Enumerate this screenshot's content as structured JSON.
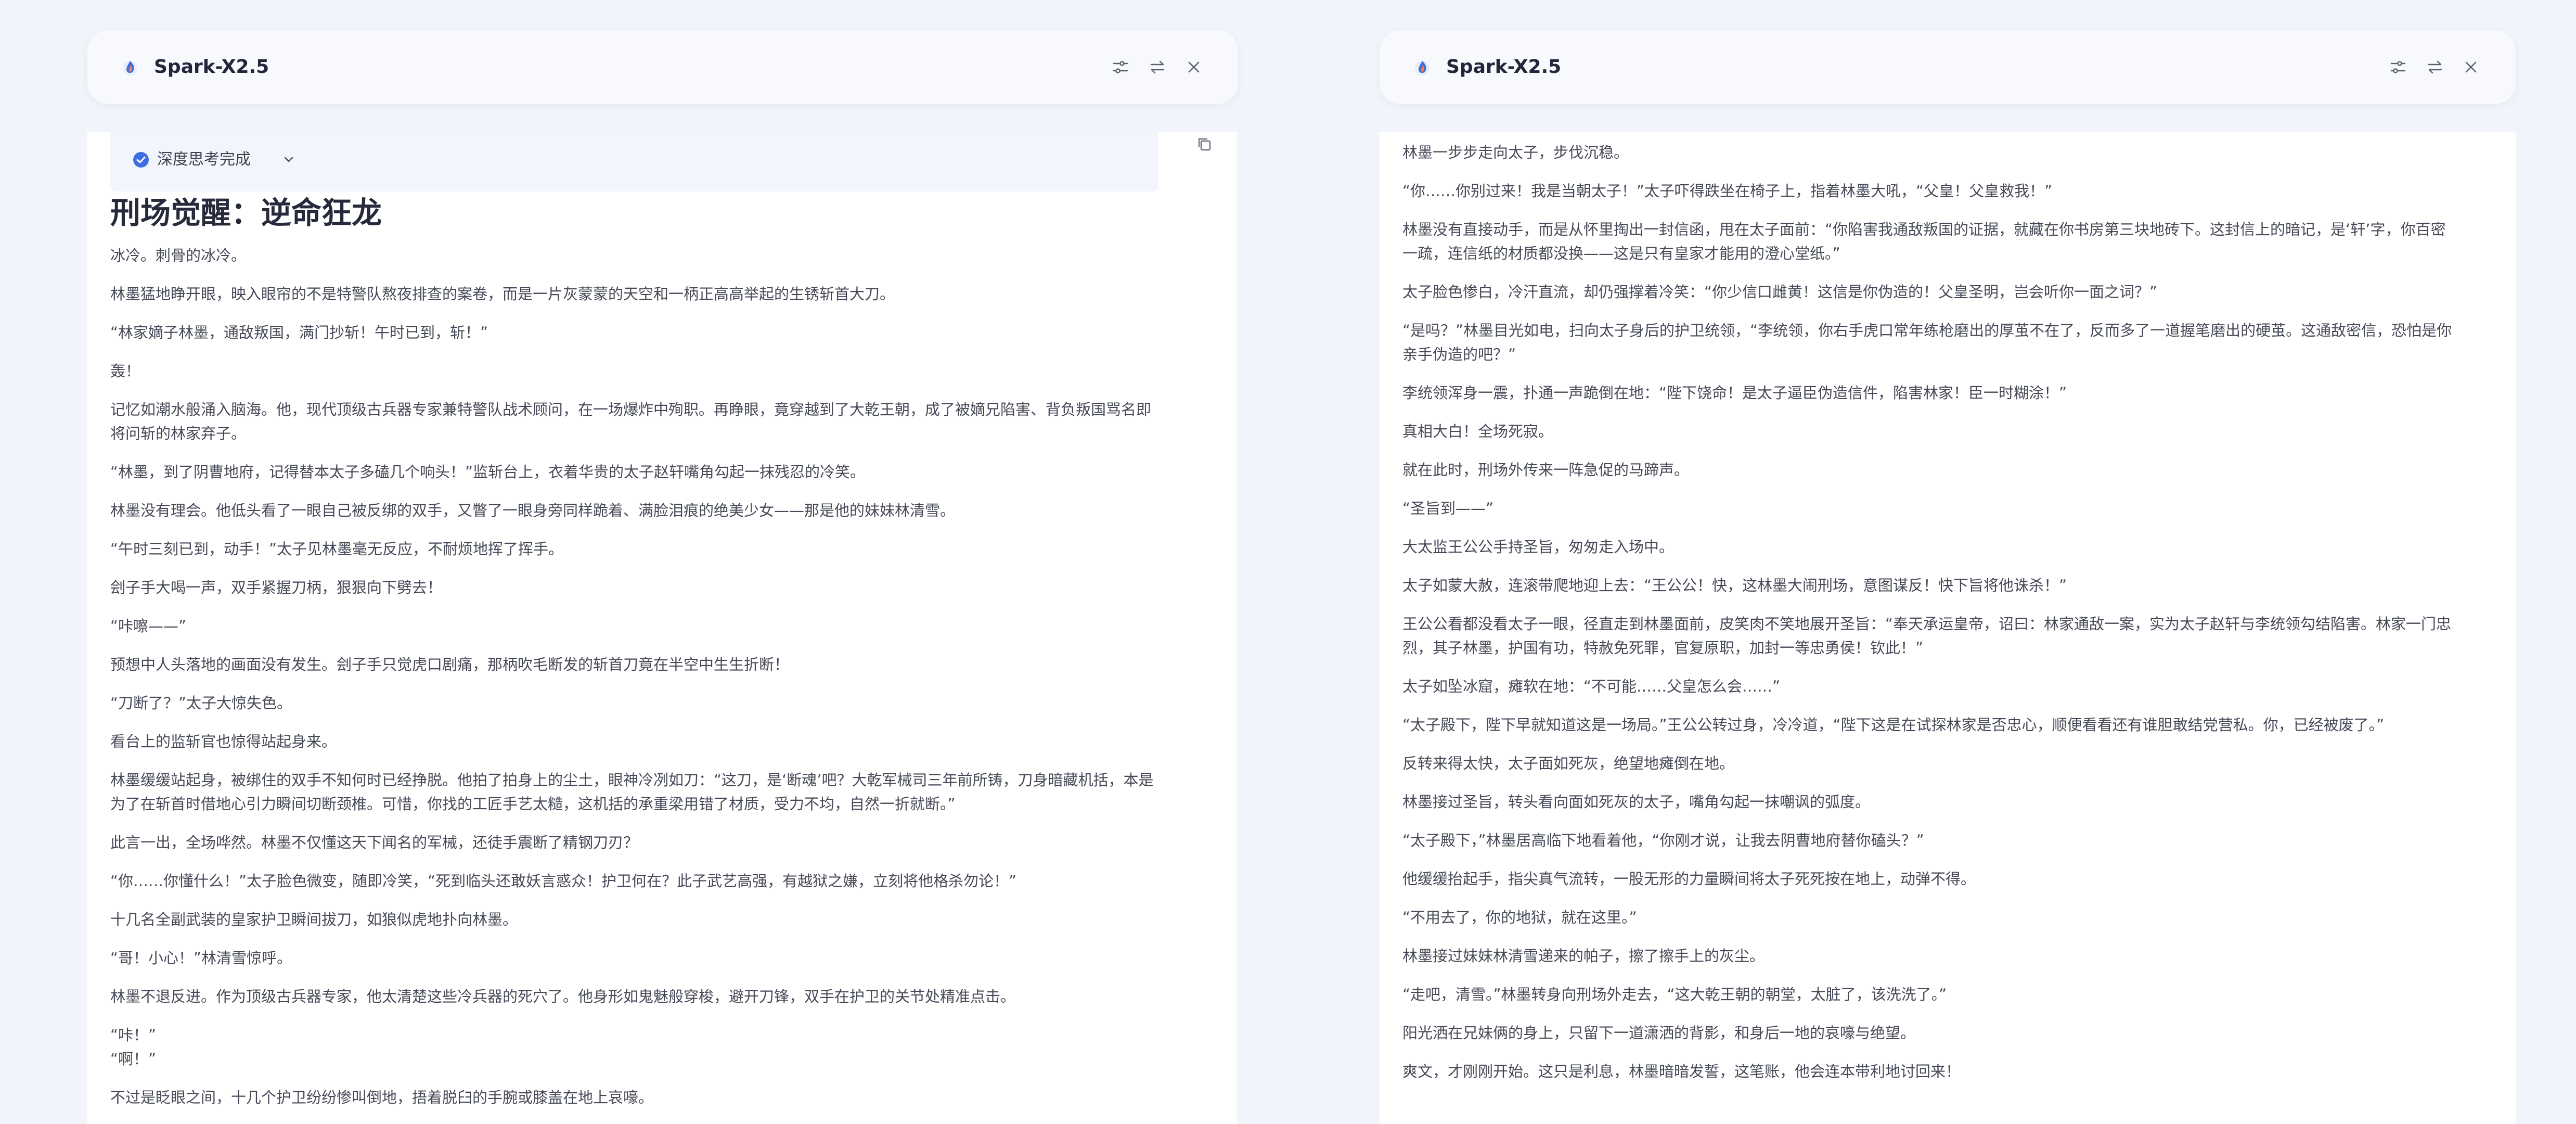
{
  "app": {
    "title": "Spark-X2.5"
  },
  "icons": {
    "logo": "flame-logo-icon",
    "settings": "sliders-icon",
    "swap": "swap-arrows-icon",
    "close": "close-icon",
    "check": "check-circle-icon",
    "chevron": "chevron-down-icon",
    "copy": "copy-icon"
  },
  "colors": {
    "background": "#f2f4fb",
    "accent": "#3e6fe0",
    "title": "#262a3b",
    "text": "#464957"
  },
  "left": {
    "thinking_label": "深度思考完成",
    "title": "刑场觉醒：逆命狂龙",
    "paragraphs": [
      "冰冷。刺骨的冰冷。",
      "林墨猛地睁开眼，映入眼帘的不是特警队熬夜排查的案卷，而是一片灰蒙蒙的天空和一柄正高高举起的生锈斩首大刀。",
      "“林家嫡子林墨，通敌叛国，满门抄斩！午时已到，斩！”",
      "轰！",
      "记忆如潮水般涌入脑海。他，现代顶级古兵器专家兼特警队战术顾问，在一场爆炸中殉职。再睁眼，竟穿越到了大乾王朝，成了被嫡兄陷害、背负叛国骂名即将问斩的林家弃子。",
      "“林墨，到了阴曹地府，记得替本太子多磕几个响头！”监斩台上，衣着华贵的太子赵轩嘴角勾起一抹残忍的冷笑。",
      "林墨没有理会。他低头看了一眼自己被反绑的双手，又瞥了一眼身旁同样跪着、满脸泪痕的绝美少女——那是他的妹妹林清雪。",
      "“午时三刻已到，动手！”太子见林墨毫无反应，不耐烦地挥了挥手。",
      "刽子手大喝一声，双手紧握刀柄，狠狠向下劈去！",
      "“咔嚓——”",
      "预想中人头落地的画面没有发生。刽子手只觉虎口剧痛，那柄吹毛断发的斩首刀竟在半空中生生折断！",
      "“刀断了？”太子大惊失色。",
      "看台上的监斩官也惊得站起身来。",
      "林墨缓缓站起身，被绑住的双手不知何时已经挣脱。他拍了拍身上的尘土，眼神冷冽如刀：“这刀，是‘断魂’吧？大乾军械司三年前所铸，刀身暗藏机括，本是为了在斩首时借地心引力瞬间切断颈椎。可惜，你找的工匠手艺太糙，这机括的承重梁用错了材质，受力不均，自然一折就断。”",
      "此言一出，全场哗然。林墨不仅懂这天下闻名的军械，还徒手震断了精钢刀刃？",
      "“你……你懂什么！”太子脸色微变，随即冷笑，“死到临头还敢妖言惑众！护卫何在？此子武艺高强，有越狱之嫌，立刻将他格杀勿论！”",
      "十几名全副武装的皇家护卫瞬间拔刀，如狼似虎地扑向林墨。",
      "“哥！小心！”林清雪惊呼。",
      "林墨不退反进。作为顶级古兵器专家，他太清楚这些冷兵器的死穴了。他身形如鬼魅般穿梭，避开刀锋，双手在护卫的关节处精准点击。",
      "“咔！”<br>“啊！”",
      "不过是眨眼之间，十几个护卫纷纷惨叫倒地，捂着脱臼的手腕或膝盖在地上哀嚎。"
    ]
  },
  "right": {
    "paragraphs": [
      "林墨一步步走向太子，步伐沉稳。",
      "“你……你别过来！我是当朝太子！”太子吓得跌坐在椅子上，指着林墨大吼，“父皇！父皇救我！”",
      "林墨没有直接动手，而是从怀里掏出一封信函，甩在太子面前：“你陷害我通敌叛国的证据，就藏在你书房第三块地砖下。这封信上的暗记，是‘轩’字，你百密一疏，连信纸的材质都没换——这是只有皇家才能用的澄心堂纸。”",
      "太子脸色惨白，冷汗直流，却仍强撑着冷笑：“你少信口雌黄！这信是你伪造的！父皇圣明，岂会听你一面之词？”",
      "“是吗？”林墨目光如电，扫向太子身后的护卫统领，“李统领，你右手虎口常年练枪磨出的厚茧不在了，反而多了一道握笔磨出的硬茧。这通敌密信，恐怕是你亲手伪造的吧？”",
      "李统领浑身一震，扑通一声跪倒在地：“陛下饶命！是太子逼臣伪造信件，陷害林家！臣一时糊涂！”",
      "真相大白！全场死寂。",
      "就在此时，刑场外传来一阵急促的马蹄声。",
      "“圣旨到——”",
      "大太监王公公手持圣旨，匆匆走入场中。",
      "太子如蒙大赦，连滚带爬地迎上去：“王公公！快，这林墨大闹刑场，意图谋反！快下旨将他诛杀！”",
      "王公公看都没看太子一眼，径直走到林墨面前，皮笑肉不笑地展开圣旨：“奉天承运皇帝，诏曰：林家通敌一案，实为太子赵轩与李统领勾结陷害。林家一门忠烈，其子林墨，护国有功，特赦免死罪，官复原职，加封一等忠勇侯！钦此！”",
      "太子如坠冰窟，瘫软在地：“不可能……父皇怎么会……”",
      "“太子殿下，陛下早就知道这是一场局。”王公公转过身，冷冷道，“陛下这是在试探林家是否忠心，顺便看看还有谁胆敢结党营私。你，已经被废了。”",
      "反转来得太快，太子面如死灰，绝望地瘫倒在地。",
      "林墨接过圣旨，转头看向面如死灰的太子，嘴角勾起一抹嘲讽的弧度。",
      "“太子殿下，”林墨居高临下地看着他，“你刚才说，让我去阴曹地府替你磕头？”",
      "他缓缓抬起手，指尖真气流转，一股无形的力量瞬间将太子死死按在地上，动弹不得。",
      "“不用去了，你的地狱，就在这里。”",
      "林墨接过妹妹林清雪递来的帕子，擦了擦手上的灰尘。",
      "“走吧，清雪。”林墨转身向刑场外走去，“这大乾王朝的朝堂，太脏了，该洗洗了。”",
      "阳光洒在兄妹俩的身上，只留下一道潇洒的背影，和身后一地的哀嚎与绝望。",
      "爽文，才刚刚开始。这只是利息，林墨暗暗发誓，这笔账，他会连本带利地讨回来！"
    ]
  }
}
